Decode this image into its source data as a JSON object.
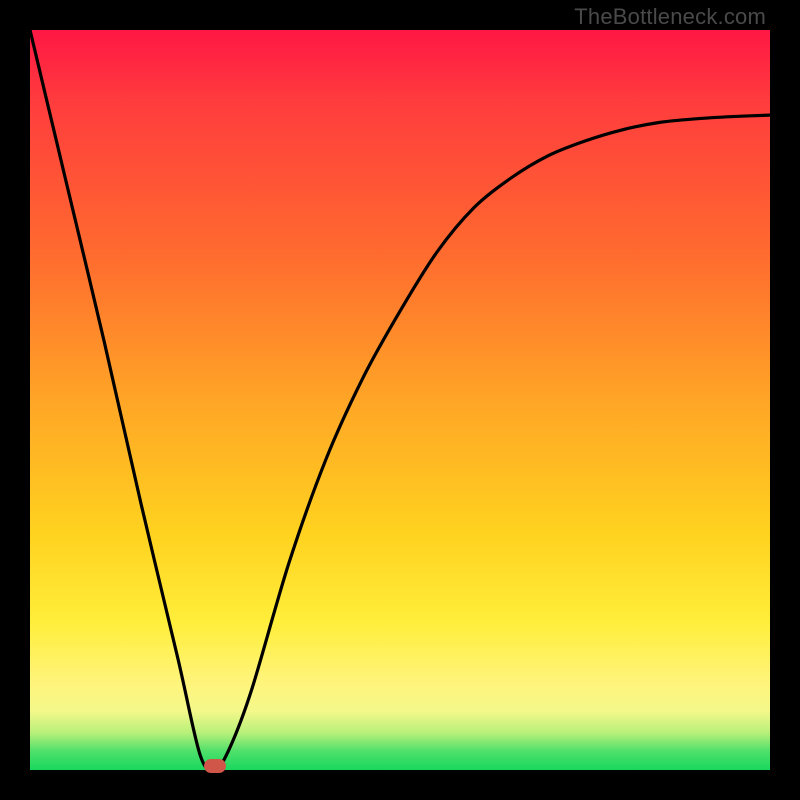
{
  "watermark": "TheBottleneck.com",
  "colors": {
    "curve": "#000000",
    "marker": "#d0564a",
    "background_black": "#000000"
  },
  "chart_data": {
    "type": "line",
    "title": "",
    "xlabel": "",
    "ylabel": "",
    "xlim": [
      0,
      100
    ],
    "ylim": [
      0,
      100
    ],
    "grid": false,
    "series": [
      {
        "name": "bottleneck-curve",
        "x": [
          0,
          5,
          10,
          15,
          20,
          23,
          25,
          27,
          30,
          35,
          40,
          45,
          50,
          55,
          60,
          65,
          70,
          75,
          80,
          85,
          90,
          95,
          100
        ],
        "y": [
          100,
          79,
          58,
          36,
          15,
          2,
          0,
          3,
          11,
          28,
          42,
          53,
          62,
          70,
          76,
          80,
          83,
          85,
          86.5,
          87.5,
          88,
          88.3,
          88.5
        ]
      }
    ],
    "annotations": [
      {
        "name": "optimal-point",
        "x": 25,
        "y": 0
      }
    ]
  }
}
